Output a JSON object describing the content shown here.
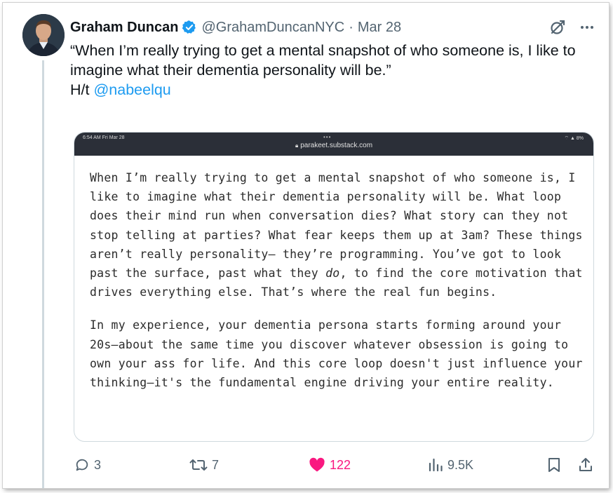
{
  "tweet": {
    "author_name": "Graham Duncan",
    "handle": "@GrahamDuncanNYC",
    "separator": "·",
    "date": "Mar 28",
    "text_line": "“When I’m really trying to get a mental snapshot of who someone is, I like to imagine what their dementia personality will be.”",
    "ht_prefix": "H/t ",
    "ht_mention": "@nabeelqu",
    "accent_color": "#1d9bf0"
  },
  "embed": {
    "status_left": "6:54 AM   Fri Mar 28",
    "status_dots": "•••",
    "status_right": "⌔ ▲ 8%",
    "url": "parakeet.substack.com",
    "paragraph1_a": "When I’m really trying to get a mental snapshot of who someone is, I like to imagine what their dementia personality will be. What loop does their mind run when conversation dies? What story can they not stop telling at parties? What fear keeps them up at 3am? These things aren’t really personality— they’re programming. You’ve got to look past the surface, past what they ",
    "paragraph1_em": "do",
    "paragraph1_b": ", to find the core motivation that drives everything else. That’s where the real fun begins.",
    "paragraph2": "In my experience, your dementia persona starts forming around your 20s—about the same time you discover whatever obsession is going to own your ass for life. And this core loop doesn't just influence your thinking—it's the fundamental engine driving your entire reality."
  },
  "actions": {
    "replies": "3",
    "reposts": "7",
    "likes": "122",
    "views": "9.5K",
    "like_color": "#f91880"
  }
}
